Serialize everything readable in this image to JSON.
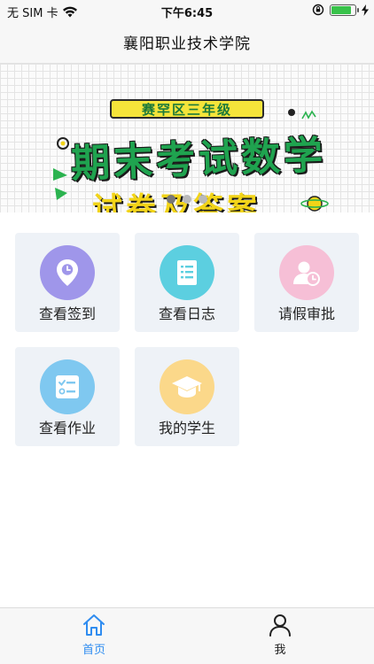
{
  "status_bar": {
    "carrier": "无 SIM 卡",
    "time": "下午6:45",
    "battery_level": 0.9
  },
  "nav": {
    "title": "襄阳职业技术学院"
  },
  "banner": {
    "tag": "赛罕区三年级",
    "title": "期末考试数学",
    "subtitle": "试卷及答案",
    "page_count": 3,
    "active_page": 1
  },
  "menu": {
    "items": [
      {
        "label": "查看签到",
        "icon": "location-clock-icon",
        "color": "#9f96ea"
      },
      {
        "label": "查看日志",
        "icon": "document-icon",
        "color": "#5ccfe0"
      },
      {
        "label": "请假审批",
        "icon": "user-clock-icon",
        "color": "#f6bfd6"
      },
      {
        "label": "查看作业",
        "icon": "checklist-icon",
        "color": "#7fc8f0"
      },
      {
        "label": "我的学生",
        "icon": "graduation-cap-icon",
        "color": "#fbd88a"
      }
    ]
  },
  "tab_bar": {
    "tabs": [
      {
        "label": "首页",
        "icon": "home-icon",
        "active": true
      },
      {
        "label": "我",
        "icon": "person-icon",
        "active": false
      }
    ],
    "active_color": "#2f8cf0",
    "inactive_color": "#222222"
  }
}
